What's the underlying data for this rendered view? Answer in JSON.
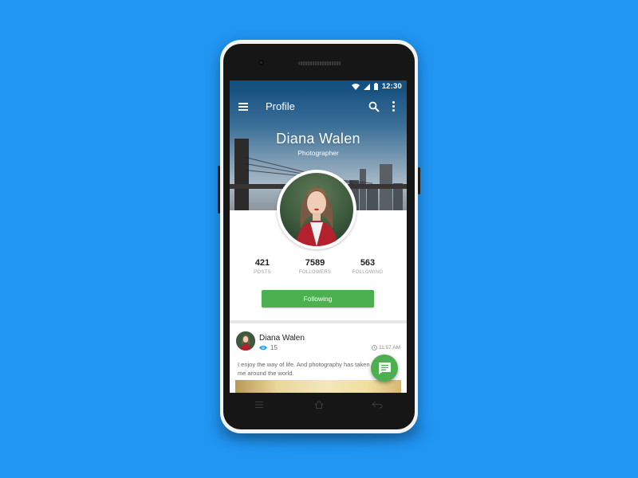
{
  "colors": {
    "background": "#2196F3",
    "accent_green": "#4CAF50",
    "status_bar": "#155280",
    "view_icon_blue": "#2196F3"
  },
  "status_bar": {
    "time": "12:30",
    "icons": [
      "wifi-icon",
      "signal-icon",
      "battery-icon"
    ]
  },
  "toolbar": {
    "title": "Profile",
    "icons": [
      "menu-icon",
      "search-icon",
      "more-vert-icon"
    ]
  },
  "profile": {
    "name": "Diana Walen",
    "role": "Photographer"
  },
  "stats": [
    {
      "value": "421",
      "label": "POSTS"
    },
    {
      "value": "7589",
      "label": "FOLLOWERS"
    },
    {
      "value": "563",
      "label": "FOLLOWING"
    }
  ],
  "follow_button": {
    "label": "Following"
  },
  "post": {
    "author": "Diana Walen",
    "views": "15",
    "time": "11:57 AM",
    "text": "I enjoy the way of life. And photography has taken me around the world."
  },
  "fab": {
    "icon": "chat-icon"
  },
  "nav_bar": {
    "icons": [
      "menu-key-icon",
      "home-key-icon",
      "back-key-icon"
    ]
  }
}
